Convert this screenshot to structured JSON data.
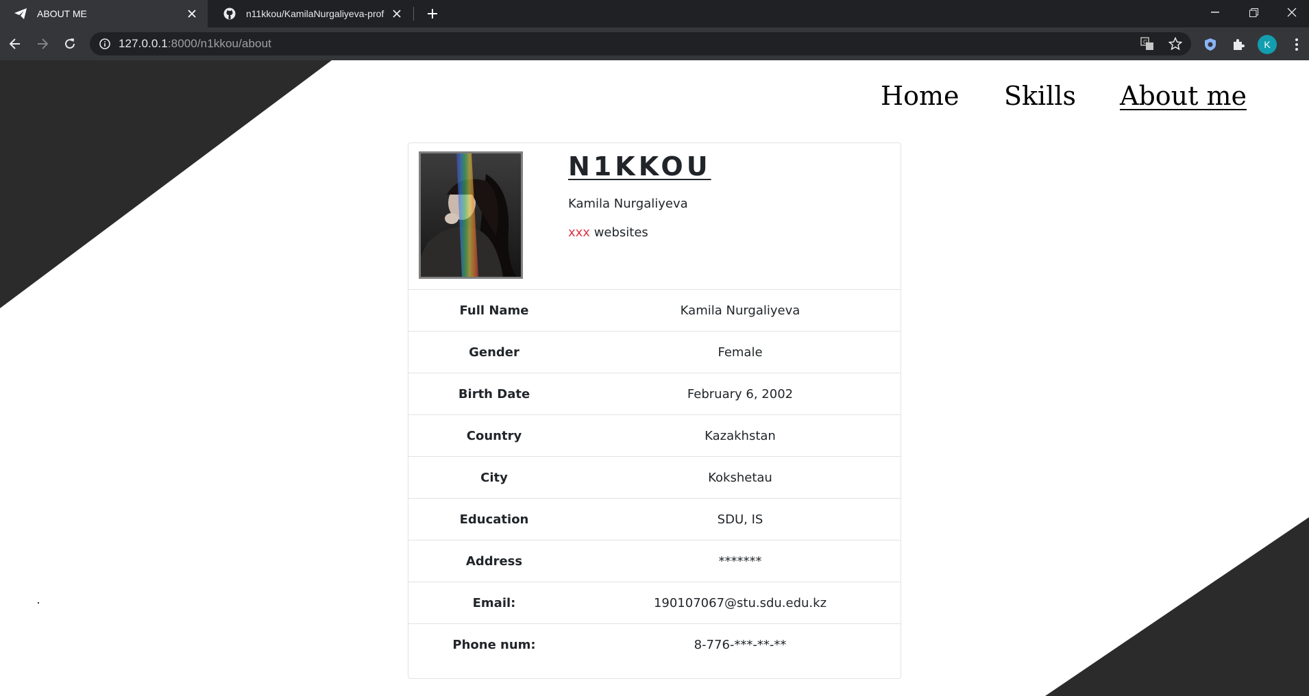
{
  "browser": {
    "tabs": [
      {
        "title": "ABOUT ME",
        "icon": "paper-plane-icon",
        "active": true
      },
      {
        "title": "n11kkou/KamilaNurgaliyeva-prof",
        "icon": "github-icon",
        "active": false
      }
    ],
    "url_host": "127.0.0.1",
    "url_rest": ":8000/n1kkou/about",
    "profile_initial": "K"
  },
  "nav": {
    "home": "Home",
    "skills": "Skills",
    "about": "About me"
  },
  "profile": {
    "nickname": "N1KKOU",
    "real_name": "Kamila Nurgaliyeva",
    "tagline_accent": "xxx",
    "tagline_rest": " websites"
  },
  "details": [
    {
      "label": "Full Name",
      "value": "Kamila Nurgaliyeva"
    },
    {
      "label": "Gender",
      "value": "Female"
    },
    {
      "label": "Birth Date",
      "value": "February 6, 2002"
    },
    {
      "label": "Country",
      "value": "Kazakhstan"
    },
    {
      "label": "City",
      "value": "Kokshetau"
    },
    {
      "label": "Education",
      "value": "SDU, IS"
    },
    {
      "label": "Address",
      "value": "*******"
    },
    {
      "label": "Email:",
      "value": "190107067@stu.sdu.edu.kz"
    },
    {
      "label": "Phone num:",
      "value": "8-776-***-**-**"
    }
  ],
  "colors": {
    "chrome_dark": "#202124",
    "chrome_mid": "#35363a",
    "decor": "#2b2b2b",
    "accent_red": "#dc3545",
    "avatar": "#129eaf"
  }
}
